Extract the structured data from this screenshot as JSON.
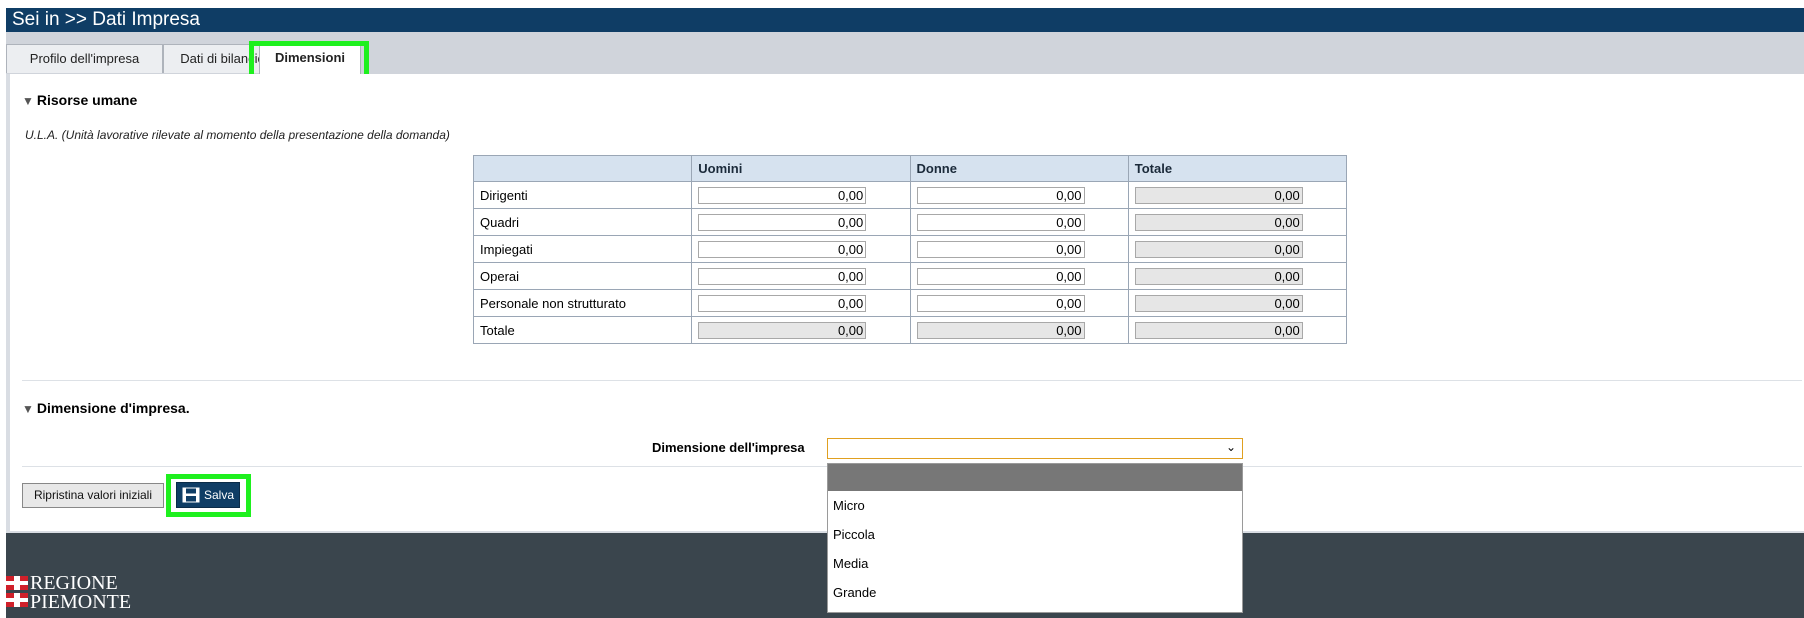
{
  "header": {
    "title": "Sei in >> Dati Impresa"
  },
  "tabs": [
    {
      "label": "Profilo dell'impresa"
    },
    {
      "label": "Dati di bilancio"
    },
    {
      "label": "Dimensioni"
    }
  ],
  "sections": {
    "risorse_umane": {
      "title": "Risorse umane",
      "subtitle": "U.L.A. (Unità lavorative rilevate al momento della presentazione della domanda)"
    },
    "dimensione": {
      "title": "Dimensione d'impresa."
    }
  },
  "ula_table": {
    "columns": [
      "",
      "Uomini",
      "Donne",
      "Totale"
    ],
    "rows": [
      {
        "label": "Dirigenti",
        "uomini": "0,00",
        "donne": "0,00",
        "totale": "0,00"
      },
      {
        "label": "Quadri",
        "uomini": "0,00",
        "donne": "0,00",
        "totale": "0,00"
      },
      {
        "label": "Impiegati",
        "uomini": "0,00",
        "donne": "0,00",
        "totale": "0,00"
      },
      {
        "label": "Operai",
        "uomini": "0,00",
        "donne": "0,00",
        "totale": "0,00"
      },
      {
        "label": "Personale non strutturato",
        "uomini": "0,00",
        "donne": "0,00",
        "totale": "0,00"
      },
      {
        "label": "Totale",
        "uomini": "0,00",
        "donne": "0,00",
        "totale": "0,00"
      }
    ]
  },
  "dimensione_form": {
    "label": "Dimensione dell'impresa",
    "selected": "",
    "options": [
      "",
      "Micro",
      "Piccola",
      "Media",
      "Grande"
    ]
  },
  "buttons": {
    "reset_label": "Ripristina valori iniziali",
    "save_label": "Salva"
  },
  "footer": {
    "logo_line1": "REGIONE",
    "logo_line2": "PIEMONTE"
  },
  "colors": {
    "header_bg": "#0f3d65",
    "highlight": "#1ef01e",
    "footer_bg": "#3a454d",
    "logo_red": "#d0202a"
  },
  "icons": {
    "section_toggle": "triangle-down-icon",
    "save": "floppy-disk-icon",
    "select": "chevron-down-icon"
  }
}
